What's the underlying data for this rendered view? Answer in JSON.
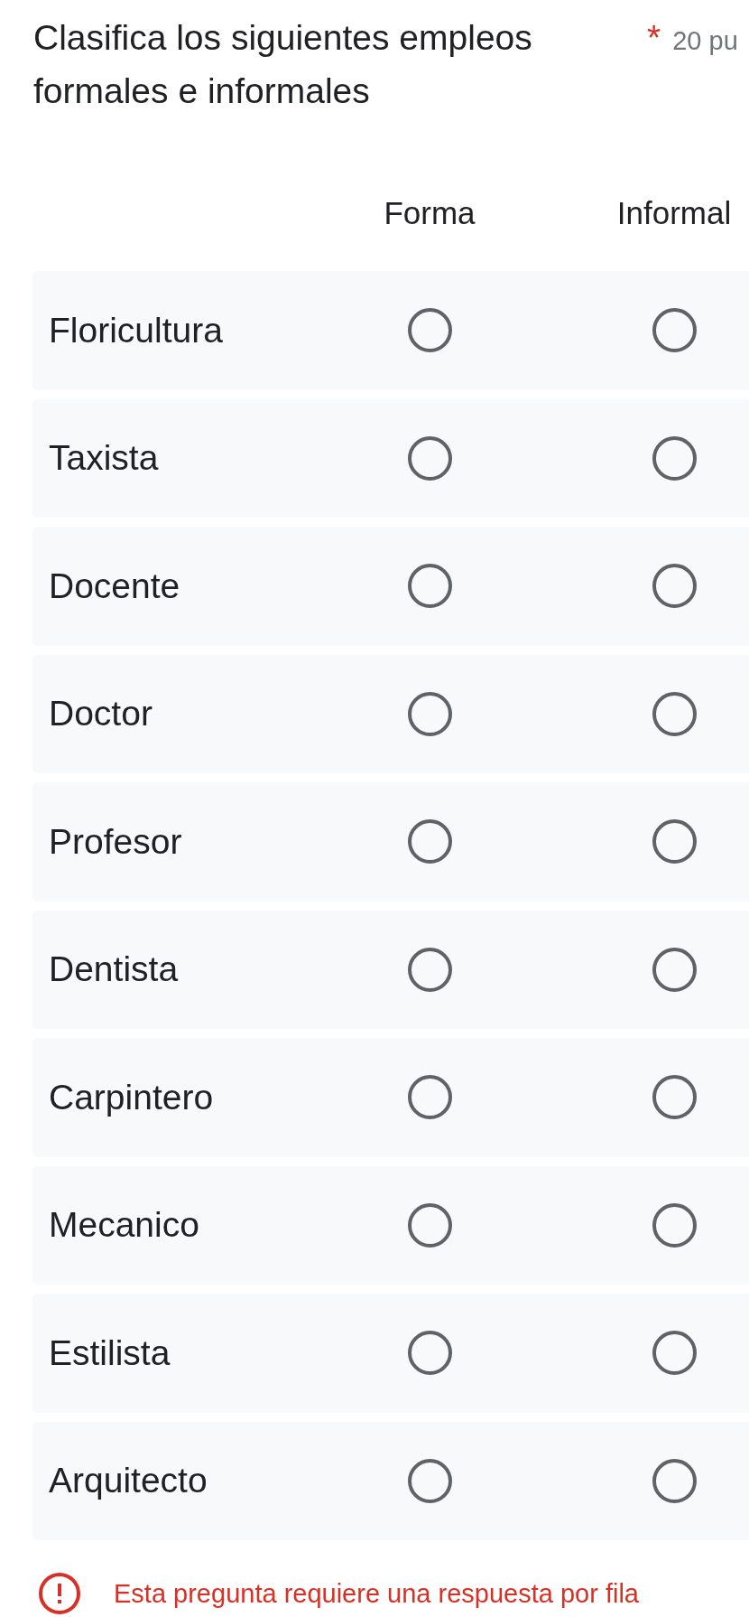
{
  "question": {
    "title": "Clasifica los siguientes empleos formales e informales",
    "required_mark": "*",
    "points": "20 pu"
  },
  "grid": {
    "columns": [
      "Forma",
      "Informal"
    ],
    "rows": [
      {
        "label": "Floricultura",
        "options": [
          {
            "selected": false
          },
          {
            "selected": false
          }
        ]
      },
      {
        "label": "Taxista",
        "options": [
          {
            "selected": false
          },
          {
            "selected": false
          }
        ]
      },
      {
        "label": "Docente",
        "options": [
          {
            "selected": false
          },
          {
            "selected": false
          }
        ]
      },
      {
        "label": "Doctor",
        "options": [
          {
            "selected": false
          },
          {
            "selected": false
          }
        ]
      },
      {
        "label": "Profesor",
        "options": [
          {
            "selected": false
          },
          {
            "selected": false
          }
        ]
      },
      {
        "label": "Dentista",
        "options": [
          {
            "selected": false
          },
          {
            "selected": false
          }
        ]
      },
      {
        "label": "Carpintero",
        "options": [
          {
            "selected": false
          },
          {
            "selected": false
          }
        ]
      },
      {
        "label": "Mecanico",
        "options": [
          {
            "selected": false
          },
          {
            "selected": false
          }
        ]
      },
      {
        "label": "Estilista",
        "options": [
          {
            "selected": false
          },
          {
            "selected": false
          }
        ]
      },
      {
        "label": "Arquitecto",
        "options": [
          {
            "selected": false
          },
          {
            "selected": false
          }
        ]
      }
    ]
  },
  "error": {
    "message": "Esta pregunta requiere una respuesta por fila"
  }
}
